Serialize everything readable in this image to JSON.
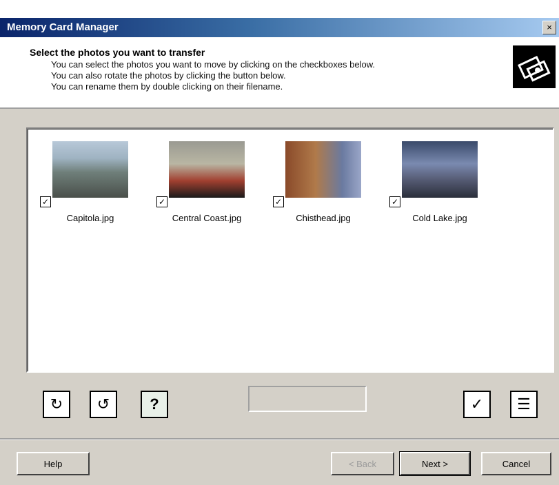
{
  "window": {
    "title": "Memory Card Manager",
    "close_glyph": "×"
  },
  "header": {
    "heading": "Select the photos you want to transfer",
    "lines": [
      "You can select the photos you want to move by clicking on the checkboxes below.",
      "You can also rotate the photos by clicking the button below.",
      "You can rename them by double clicking on their filename."
    ],
    "icon": "camera-transfer-icon"
  },
  "photos": [
    {
      "name": "Capitola.jpg",
      "checked": true
    },
    {
      "name": "Central Coast.jpg",
      "checked": true
    },
    {
      "name": "Chisthead.jpg",
      "checked": true
    },
    {
      "name": "Cold Lake.jpg",
      "checked": true
    }
  ],
  "check_glyph": "✓",
  "toolbar": {
    "rotate_right_icon": "rotate-right-icon",
    "rotate_left_icon": "rotate-left-icon",
    "help_photo_icon": "photo-help-icon",
    "help_glyph": "?",
    "select_all_icon": "check-all-icon",
    "select_none_icon": "uncheck-all-icon"
  },
  "buttons": {
    "help": "Help",
    "back": "< Back",
    "next": "Next >",
    "cancel": "Cancel"
  }
}
